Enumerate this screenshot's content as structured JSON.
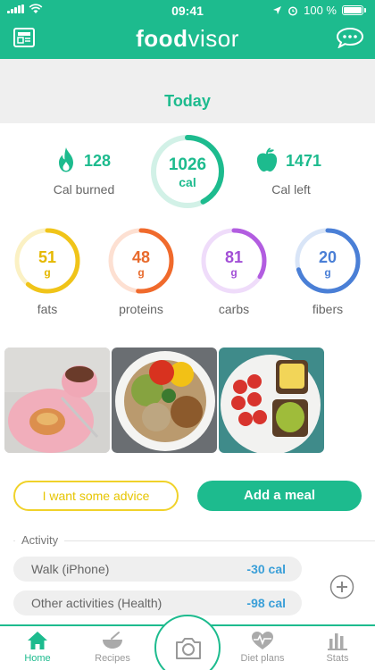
{
  "status_bar": {
    "time": "09:41",
    "battery": "100 %"
  },
  "header": {
    "logo_bold": "food",
    "logo_light": "visor",
    "left_icon": "news-icon",
    "right_icon": "chat-icon"
  },
  "today": {
    "label": "Today"
  },
  "calories": {
    "consumed": "1026",
    "unit": "cal",
    "burned_value": "128",
    "burned_label": "Cal burned",
    "left_value": "1471",
    "left_label": "Cal left"
  },
  "macros": [
    {
      "value": "51",
      "unit": "g",
      "label": "fats",
      "color": "#f0c419",
      "light": "#fbf1c4"
    },
    {
      "value": "48",
      "unit": "g",
      "label": "proteins",
      "color": "#f06a2c",
      "light": "#fde0d2"
    },
    {
      "value": "81",
      "unit": "g",
      "label": "carbs",
      "color": "#b25de0",
      "light": "#efdcfa"
    },
    {
      "value": "20",
      "unit": "g",
      "label": "fibers",
      "color": "#4a7fd6",
      "light": "#d9e5f7"
    }
  ],
  "buttons": {
    "advice": "I want some advice",
    "add_meal": "Add a meal"
  },
  "activity": {
    "title": "Activity",
    "items": [
      {
        "name": "Walk (iPhone)",
        "cal": "-30 cal"
      },
      {
        "name": "Other activities (Health)",
        "cal": "-98 cal"
      }
    ]
  },
  "tabs": [
    {
      "label": "Home",
      "icon": "home-icon",
      "active": true
    },
    {
      "label": "Recipes",
      "icon": "bowl-icon",
      "active": false
    },
    {
      "label": "",
      "icon": "camera-icon",
      "active": false
    },
    {
      "label": "Diet plans",
      "icon": "heart-pulse-icon",
      "active": false
    },
    {
      "label": "Stats",
      "icon": "stats-icon",
      "active": false
    }
  ],
  "colors": {
    "brand": "#1dbb8e",
    "activity_cal": "#3a9fd8",
    "advice": "#f0d22a"
  }
}
